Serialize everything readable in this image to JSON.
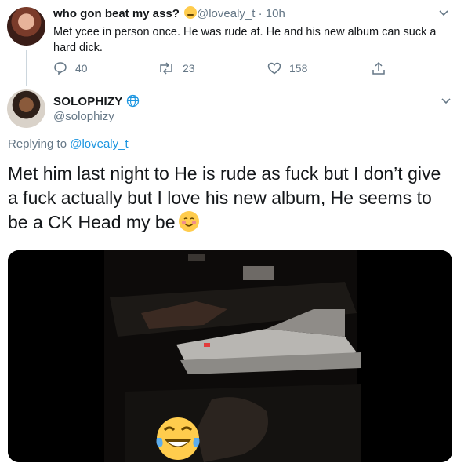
{
  "parent_tweet": {
    "display_name": "who gon beat my ass?",
    "handle_time": "@lovealy_t · 10h",
    "text": "Met ycee in person once. He was rude af. He and his new album can suck a hard dick.",
    "replies": "40",
    "retweets": "23",
    "likes": "158"
  },
  "reply_tweet": {
    "display_name": "SOLOPHIZY",
    "handle": "@solophizy",
    "replying_to_label": "Replying to",
    "replying_to_handle": "@lovealy_t",
    "text": "Met him last night to He is rude as fuck but I don’t give a fuck actually but I love his new album, He seems to be a CK Head my be"
  },
  "icons": {
    "reply": "reply-icon",
    "retweet": "retweet-icon",
    "like": "heart-icon",
    "share": "share-icon",
    "more": "chevron-down-icon",
    "verified_globe": "globe-icon"
  },
  "colors": {
    "muted": "#657786",
    "link": "#1b95e0",
    "text": "#14171a",
    "divider": "#e6ecf0"
  }
}
